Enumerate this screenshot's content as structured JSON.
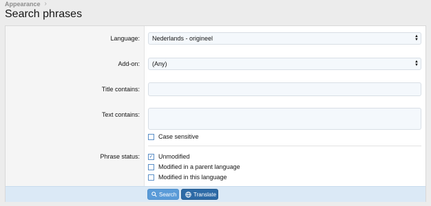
{
  "breadcrumb": {
    "item": "Appearance"
  },
  "page": {
    "title": "Search phrases"
  },
  "form": {
    "language": {
      "label": "Language:",
      "value": "Nederlands - origineel"
    },
    "addon": {
      "label": "Add-on:",
      "value": "(Any)"
    },
    "title_contains": {
      "label": "Title contains:",
      "value": ""
    },
    "text_contains": {
      "label": "Text contains:",
      "value": ""
    },
    "case_sensitive": {
      "label": "Case sensitive",
      "checked": false
    },
    "phrase_status": {
      "label": "Phrase status:",
      "options": [
        {
          "label": "Unmodified",
          "checked": true
        },
        {
          "label": "Modified in a parent language",
          "checked": false
        },
        {
          "label": "Modified in this language",
          "checked": false
        }
      ]
    }
  },
  "buttons": {
    "search": "Search",
    "translate": "Translate"
  },
  "colors": {
    "accent": "#2d6aa6",
    "button_light": "#5a9bd8"
  }
}
